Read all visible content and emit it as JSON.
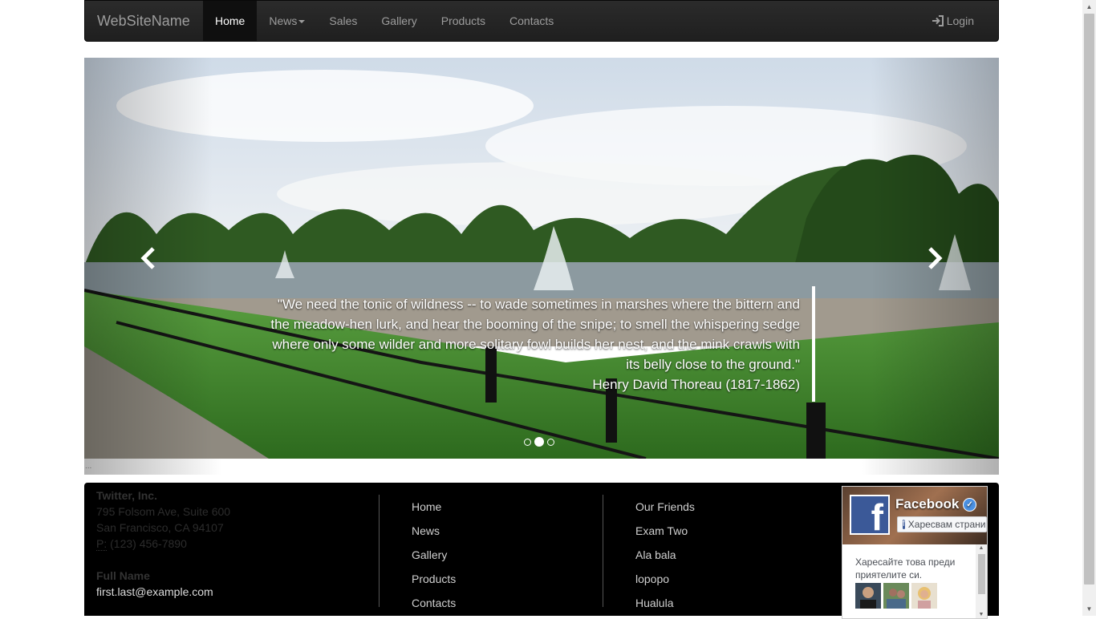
{
  "navbar": {
    "brand": "WebSiteName",
    "items": [
      {
        "label": "Home",
        "active": true
      },
      {
        "label": "News",
        "dropdown": true
      },
      {
        "label": "Sales"
      },
      {
        "label": "Gallery"
      },
      {
        "label": "Products"
      },
      {
        "label": "Contacts"
      }
    ],
    "login_label": "Login"
  },
  "carousel": {
    "quote": "\"We need the tonic of wildness -- to wade sometimes in marshes where the bittern and the meadow-hen lurk, and hear the booming of the snipe; to smell the whispering sedge where only some wilder and more solitary fowl builds her nest, and the mink crawls with its belly close to the ground.\"",
    "author": "Henry David Thoreau (1817-1862)",
    "slide_count": 3,
    "active_slide": 2
  },
  "strip_text": "...",
  "footer": {
    "company": "Twitter, Inc.",
    "address_line1": "795 Folsom Ave, Suite 600",
    "address_line2": "San Francisco, CA 94107",
    "phone_abbr": "P:",
    "phone": "(123) 456-7890",
    "contact_name": "Full Name",
    "email": "first.last@example.com",
    "links_col1": [
      "Home",
      "News",
      "Gallery",
      "Products",
      "Contacts"
    ],
    "links_col2": [
      "Our Friends",
      "Exam Two",
      "Ala bala",
      "lopopo",
      "Hualula"
    ]
  },
  "facebook": {
    "page_name": "Facebook",
    "like_button": "Харесвам страницата",
    "prompt": "Харесайте това преди приятелите си."
  }
}
